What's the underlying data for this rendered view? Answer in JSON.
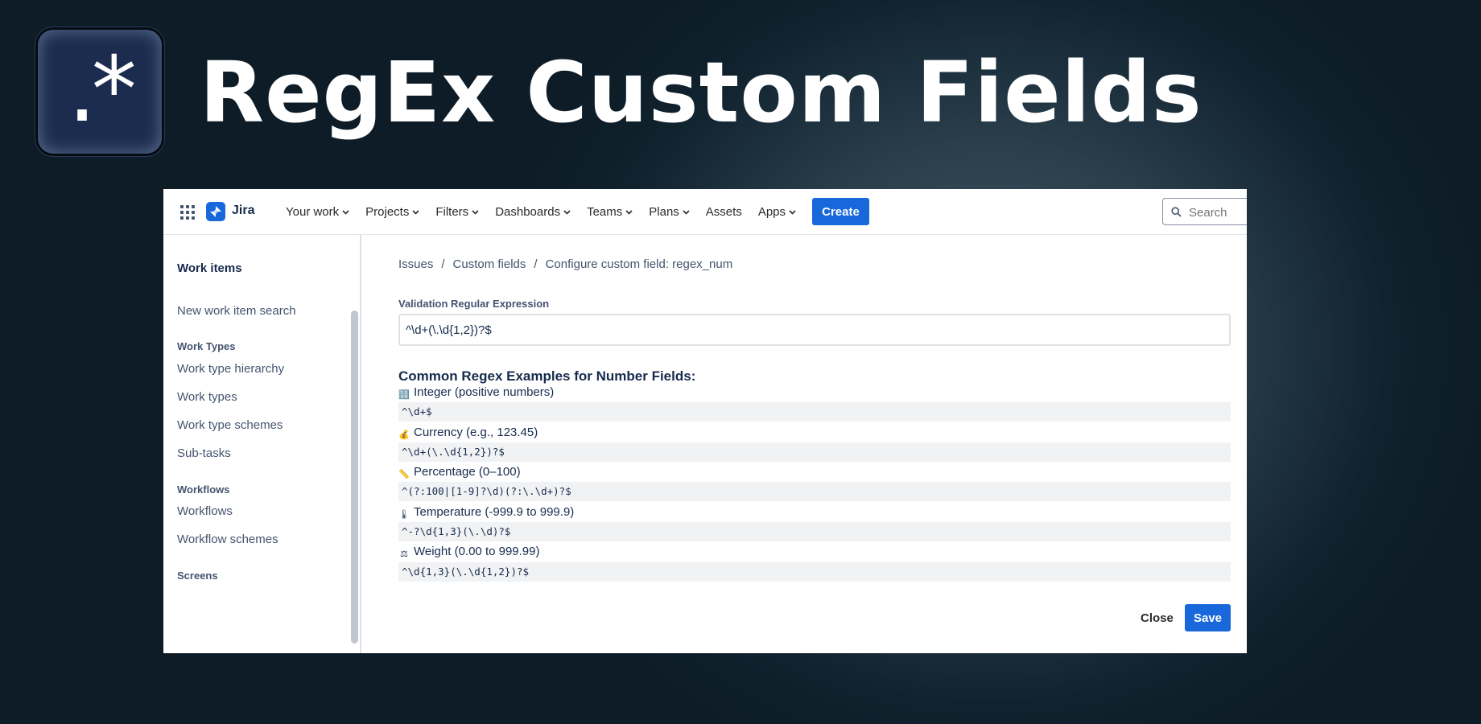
{
  "banner": {
    "logo_text": ".*",
    "title": "RegEx Custom Fields"
  },
  "topnav": {
    "app_name": "Jira",
    "items": [
      {
        "label": "Your work",
        "has_dropdown": true
      },
      {
        "label": "Projects",
        "has_dropdown": true
      },
      {
        "label": "Filters",
        "has_dropdown": true
      },
      {
        "label": "Dashboards",
        "has_dropdown": true
      },
      {
        "label": "Teams",
        "has_dropdown": true
      },
      {
        "label": "Plans",
        "has_dropdown": true
      },
      {
        "label": "Assets",
        "has_dropdown": false
      },
      {
        "label": "Apps",
        "has_dropdown": true
      }
    ],
    "create_label": "Create",
    "search_placeholder": "Search"
  },
  "sidebar": {
    "title": "Work items",
    "new_search": "New work item search",
    "group_work_types": "Work Types",
    "work_type_hierarchy": "Work type hierarchy",
    "work_types": "Work types",
    "work_type_schemes": "Work type schemes",
    "sub_tasks": "Sub-tasks",
    "group_workflows": "Workflows",
    "workflows": "Workflows",
    "workflow_schemes": "Workflow schemes",
    "group_screens": "Screens"
  },
  "breadcrumb": {
    "items": [
      "Issues",
      "Custom fields",
      "Configure custom field: regex_num"
    ],
    "separator": "/"
  },
  "form": {
    "label": "Validation Regular Expression",
    "value": "^\\d+(\\.\\d{1,2})?$"
  },
  "examples": {
    "heading": "Common Regex Examples for Number Fields:",
    "items": [
      {
        "emoji": "🔢",
        "label": "Integer (positive numbers)",
        "pattern": "^\\d+$"
      },
      {
        "emoji": "💰",
        "label": "Currency (e.g., 123.45)",
        "pattern": "^\\d+(\\.\\d{1,2})?$"
      },
      {
        "emoji": "📏",
        "label": "Percentage (0–100)",
        "pattern": "^(?:100|[1-9]?\\d)(?:\\.\\d+)?$"
      },
      {
        "emoji": "🌡",
        "label": "Temperature (-999.9 to 999.9)",
        "pattern": "^-?\\d{1,3}(\\.\\d)?$"
      },
      {
        "emoji": "⚖",
        "label": "Weight (0.00 to 999.99)",
        "pattern": "^\\d{1,3}(\\.\\d{1,2})?$"
      }
    ]
  },
  "actions": {
    "close_label": "Close",
    "save_label": "Save"
  },
  "colors": {
    "primary": "#1868db",
    "banner_background": "#10222e",
    "code_background": "#f1f2f4"
  }
}
